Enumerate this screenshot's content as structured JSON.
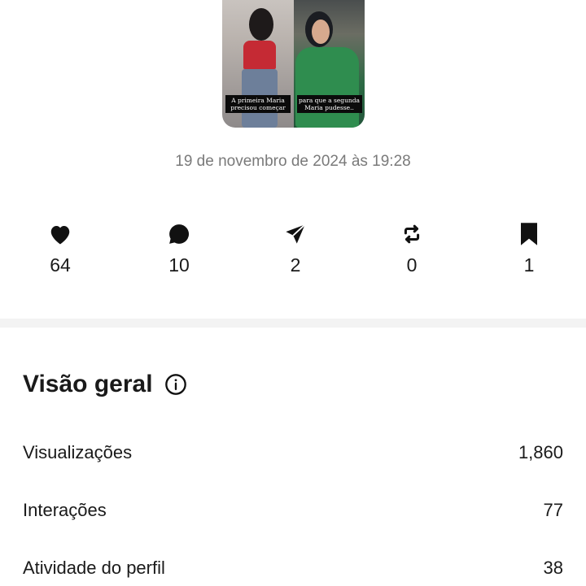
{
  "post": {
    "caption_left": "A primeira Maria precisou começar",
    "caption_right": "para que a segunda Maria pudesse..",
    "timestamp": "19 de novembro de 2024 às 19:28"
  },
  "stats": [
    {
      "icon": "heart-icon",
      "value": "64"
    },
    {
      "icon": "comment-icon",
      "value": "10"
    },
    {
      "icon": "share-icon",
      "value": "2"
    },
    {
      "icon": "repost-icon",
      "value": "0"
    },
    {
      "icon": "bookmark-icon",
      "value": "1"
    }
  ],
  "overview": {
    "title": "Visão geral",
    "rows": [
      {
        "label": "Visualizações",
        "value": "1,860"
      },
      {
        "label": "Interações",
        "value": "77"
      },
      {
        "label": "Atividade do perfil",
        "value": "38"
      }
    ]
  },
  "colors": {
    "text": "#1a1a1a",
    "muted": "#7a7a7a",
    "divider": "#f3f3f3"
  }
}
